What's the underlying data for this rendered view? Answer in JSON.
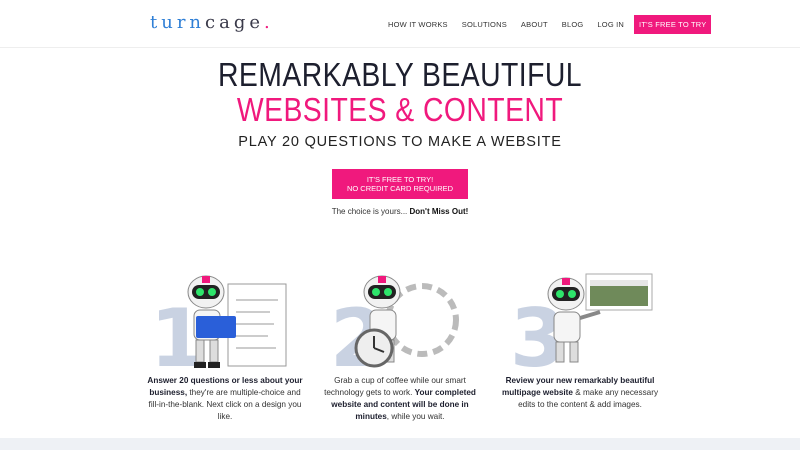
{
  "brand": {
    "logo_part1": "turn",
    "logo_part2": "cage",
    "logo_dot": "."
  },
  "nav": {
    "items": [
      "HOW IT WORKS",
      "SOLUTIONS",
      "ABOUT",
      "BLOG",
      "LOG IN"
    ],
    "cta": "IT'S FREE TO TRY"
  },
  "hero": {
    "line1": "REMARKABLY BEAUTIFUL",
    "line2": "WEBSITES & CONTENT",
    "subtitle": "PLAY 20 QUESTIONS TO MAKE A WEBSITE"
  },
  "cta_button": {
    "line1": "IT'S FREE TO TRY!",
    "line2": "NO CREDIT CARD REQUIRED"
  },
  "choice": {
    "text": "The choice is yours... ",
    "bold": "Don't Miss Out!"
  },
  "steps": [
    {
      "number": "1",
      "caption": [
        {
          "b": "Answer 20 questions or less about your business,"
        },
        {
          "t": " they're are multiple-choice and fill-in-the-blank. Next click on a design you like."
        }
      ]
    },
    {
      "number": "2",
      "caption": [
        {
          "t": "Grab a cup of coffee while our smart technology gets to work. "
        },
        {
          "b": "Your completed website and content will be done in minutes"
        },
        {
          "t": ", while you wait."
        }
      ]
    },
    {
      "number": "3",
      "caption": [
        {
          "b": "Review your new remarkably beautiful multipage website"
        },
        {
          "t": " & make any necessary edits to the content & add images."
        }
      ]
    }
  ],
  "colors": {
    "accent": "#f0197d",
    "brand_blue": "#2f7fd6",
    "dark": "#1d1f2e"
  }
}
